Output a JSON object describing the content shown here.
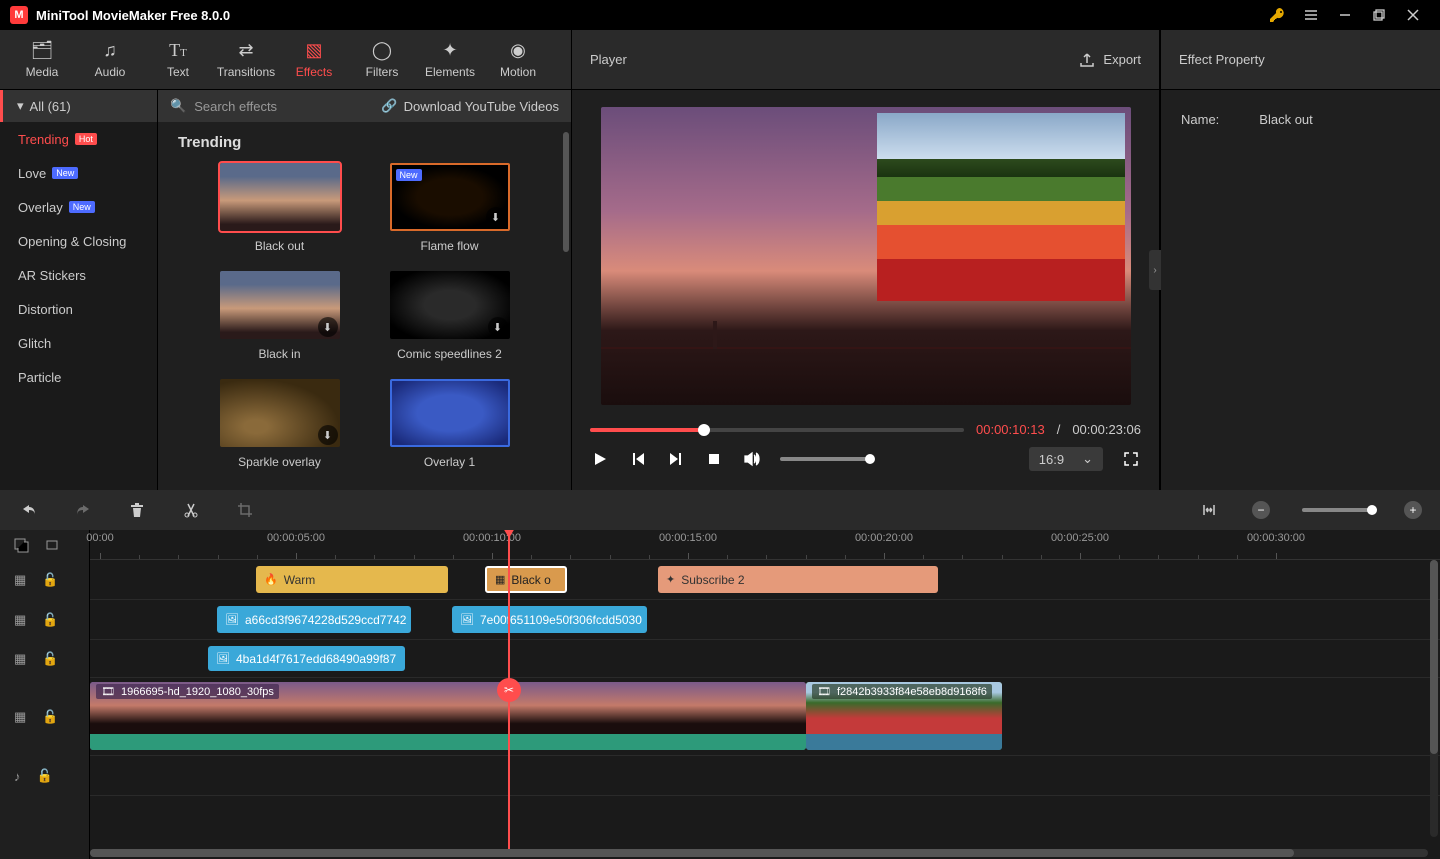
{
  "app": {
    "title": "MiniTool MovieMaker Free 8.0.0"
  },
  "maintabs": {
    "media": "Media",
    "audio": "Audio",
    "text": "Text",
    "transitions": "Transitions",
    "effects": "Effects",
    "filters": "Filters",
    "elements": "Elements",
    "motion": "Motion"
  },
  "sidebar": {
    "all": "All (61)",
    "items": [
      {
        "label": "Trending",
        "badge": "Hot",
        "badgeClass": "hot",
        "selected": true
      },
      {
        "label": "Love",
        "badge": "New",
        "badgeClass": "new"
      },
      {
        "label": "Overlay",
        "badge": "New",
        "badgeClass": "new"
      },
      {
        "label": "Opening & Closing"
      },
      {
        "label": "AR Stickers"
      },
      {
        "label": "Distortion"
      },
      {
        "label": "Glitch"
      },
      {
        "label": "Particle"
      }
    ]
  },
  "gallery": {
    "search_placeholder": "Search effects",
    "yt_link": "Download YouTube Videos",
    "heading": "Trending",
    "items": [
      {
        "label": "Black out",
        "selected": true
      },
      {
        "label": "Flame flow",
        "new": true,
        "dl": true
      },
      {
        "label": "Black in",
        "dl": true
      },
      {
        "label": "Comic speedlines 2",
        "dl": true
      },
      {
        "label": "Sparkle overlay",
        "dl": true
      },
      {
        "label": "Overlay 1"
      }
    ]
  },
  "player": {
    "title": "Player",
    "export": "Export",
    "time_current": "00:00:10:13",
    "time_separator": " / ",
    "time_duration": "00:00:23:06",
    "aspect": "16:9"
  },
  "property": {
    "title": "Effect Property",
    "name_label": "Name:",
    "name_value": "Black out"
  },
  "ruler": {
    "labels": [
      "00:00",
      "00:00:05:00",
      "00:00:10:00",
      "00:00:15:00",
      "00:00:20:00",
      "00:00:25:00",
      "00:00:30:00"
    ]
  },
  "clips": {
    "warm": "Warm",
    "blackout": "Black o",
    "subscribe": "Subscribe 2",
    "img1": "a66cd3f9674228d529ccd7742",
    "img2": "7e00f651109e50f306fcdd5030",
    "img3": "4ba1d4f7617edd68490a99f87",
    "vid1": "1966695-hd_1920_1080_30fps",
    "vid2": "f2842b3933f84e58eb8d9168f6"
  }
}
